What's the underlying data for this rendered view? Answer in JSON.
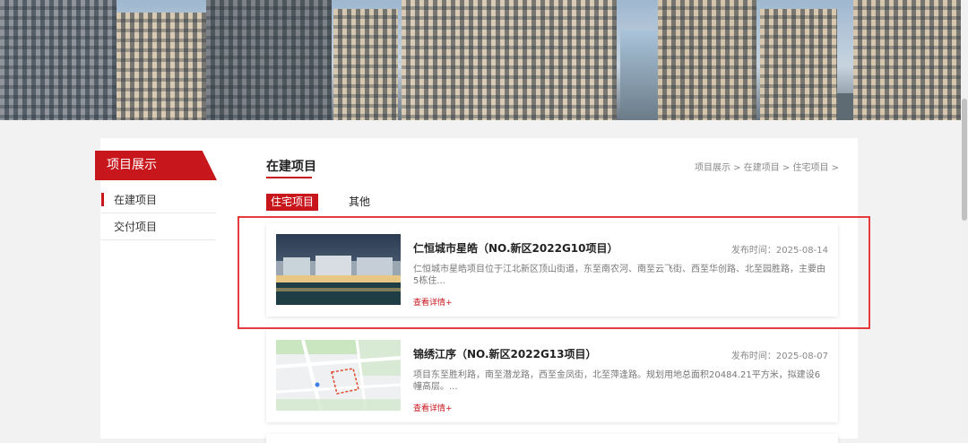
{
  "sidebar": {
    "title": "项目展示",
    "items": [
      {
        "label": "在建项目",
        "active": true
      },
      {
        "label": "交付项目",
        "active": false
      }
    ]
  },
  "section": {
    "title": "在建项目",
    "breadcrumb": "项目展示 > 在建项目 > 住宅项目 >"
  },
  "tabs": [
    {
      "label": "住宅项目",
      "active": true
    },
    {
      "label": "其他",
      "active": false
    }
  ],
  "projects": [
    {
      "title": "仁恒城市星皓（NO.新区2022G10项目）",
      "date": "发布时间：2025-08-14",
      "description": "仁恒城市星皓项目位于江北新区顶山街道，东至南农河、南至云飞街、西至华创路、北至园胜路，主要由5栋住...",
      "more": "查看详情+"
    },
    {
      "title": "锦绣江序（NO.新区2022G13项目）",
      "date": "发布时间：2025-08-07",
      "description": "项目东至胜利路，南至潜龙路，西至金凤街，北至萍逢路。规划用地总面积20484.21平方米，拟建设6幢高层。...",
      "more": "查看详情+"
    }
  ],
  "colors": {
    "accent": "#c8161d",
    "highlight": "#e53b3b"
  }
}
